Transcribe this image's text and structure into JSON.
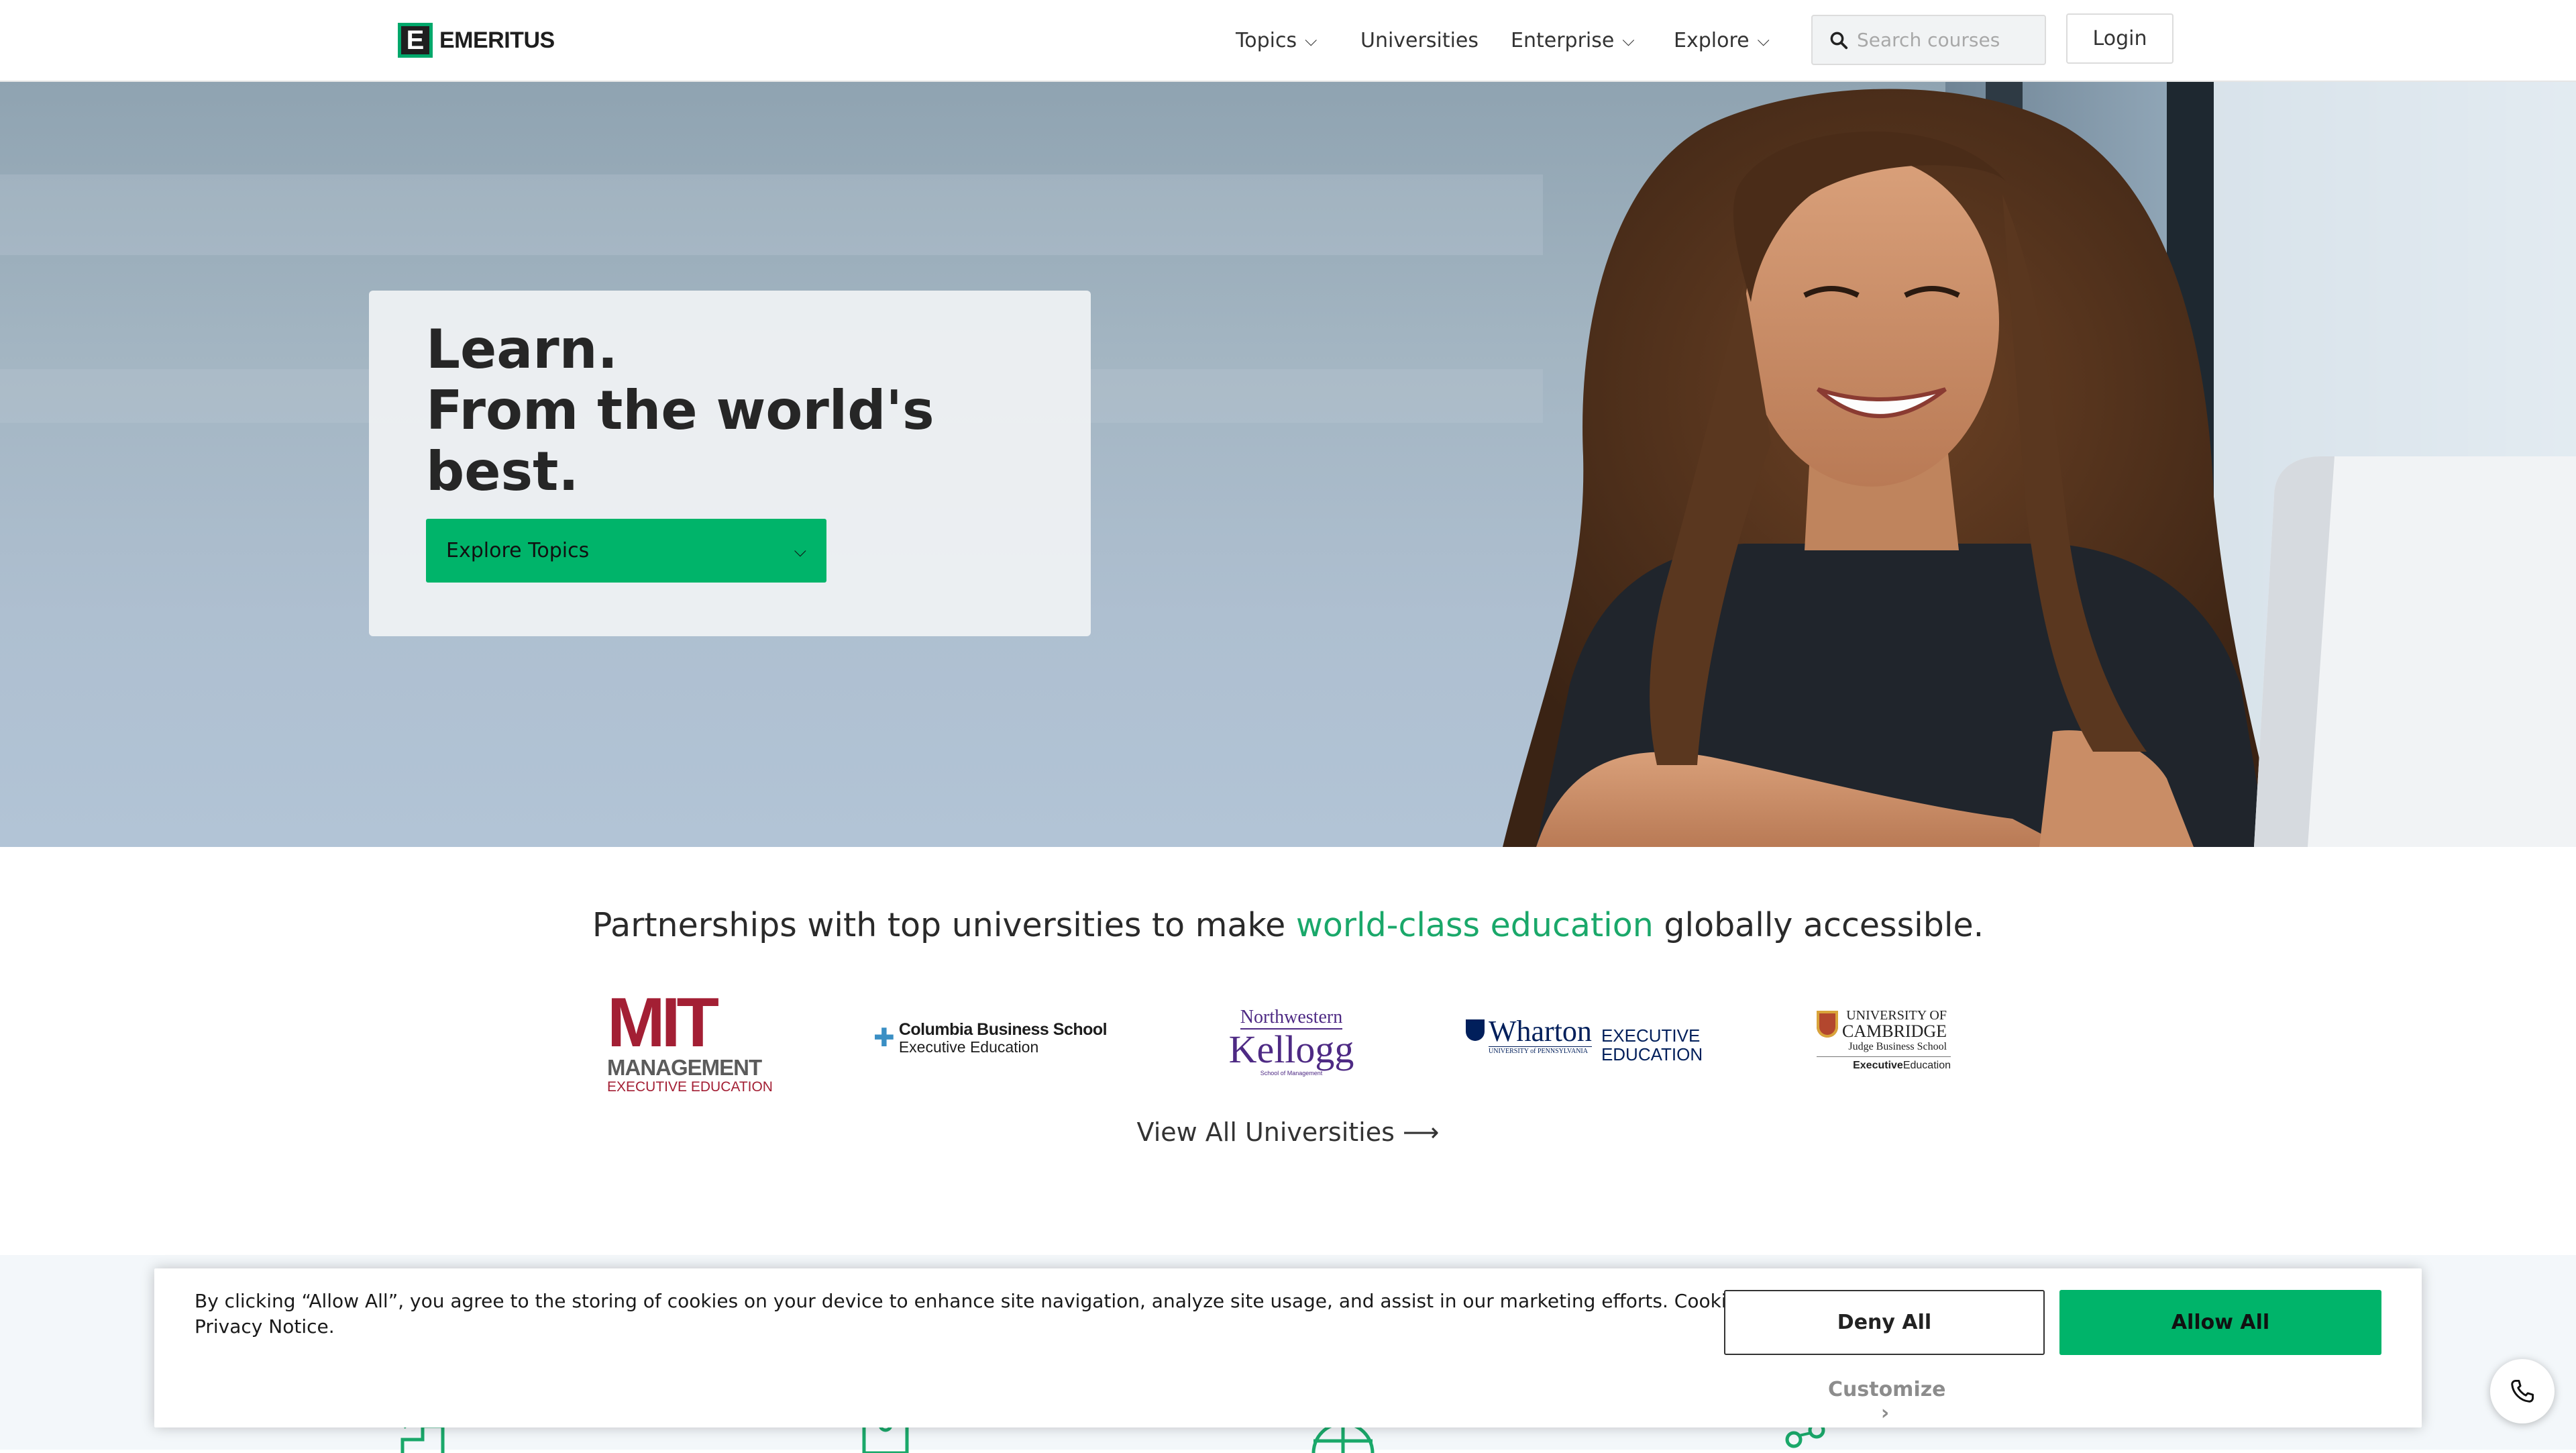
{
  "header": {
    "logo_letter": "E",
    "logo_text": "EMERITUS",
    "nav": {
      "topics": "Topics",
      "universities": "Universities",
      "enterprise": "Enterprise",
      "explore": "Explore"
    },
    "search_placeholder": "Search courses",
    "login": "Login"
  },
  "hero": {
    "title_lines": [
      "Learn.",
      "From the world's",
      "best."
    ],
    "explore_button": "Explore Topics"
  },
  "partners": {
    "heading_before": "Partnerships with top universities to make ",
    "heading_accent": "world-class education",
    "heading_after": " globally accessible.",
    "logos": {
      "mit": {
        "mark": "MIT",
        "line1": "MANAGEMENT",
        "line2": "EXECUTIVE EDUCATION"
      },
      "columbia": {
        "line1": "Columbia Business School",
        "line2": "Executive Education"
      },
      "kellogg": {
        "line1": "Northwestern",
        "line2": "Kellogg",
        "line3": "School of Management"
      },
      "wharton": {
        "line1": "Wharton",
        "line2": "UNIVERSITY of PENNSYLVANIA",
        "line3": "EXECUTIVE",
        "line4": "EDUCATION"
      },
      "cambridge": {
        "line1": "UNIVERSITY OF",
        "line2": "CAMBRIDGE",
        "line3": "Judge Business School",
        "line4a": "Executive",
        "line4b": "Education"
      }
    },
    "view_all": "View All Universities ⟶"
  },
  "cookie": {
    "text": "By clicking “Allow All”, you agree to the storing of cookies on your device to enhance site navigation, analyze site usage, and assist in our marketing efforts. Cookie Notice, Privacy Notice.",
    "deny": "Deny All",
    "allow": "Allow All",
    "customize": "Customize ›"
  },
  "icons": {
    "search": "search-icon",
    "chevron": "chevron-down-icon",
    "phone": "phone-icon"
  },
  "colors": {
    "accent_green": "#00b46a",
    "accent_text_green": "#1aa86a",
    "mit_red": "#a31f34",
    "kellogg_purple": "#4e2a84",
    "wharton_navy": "#011f5b"
  }
}
